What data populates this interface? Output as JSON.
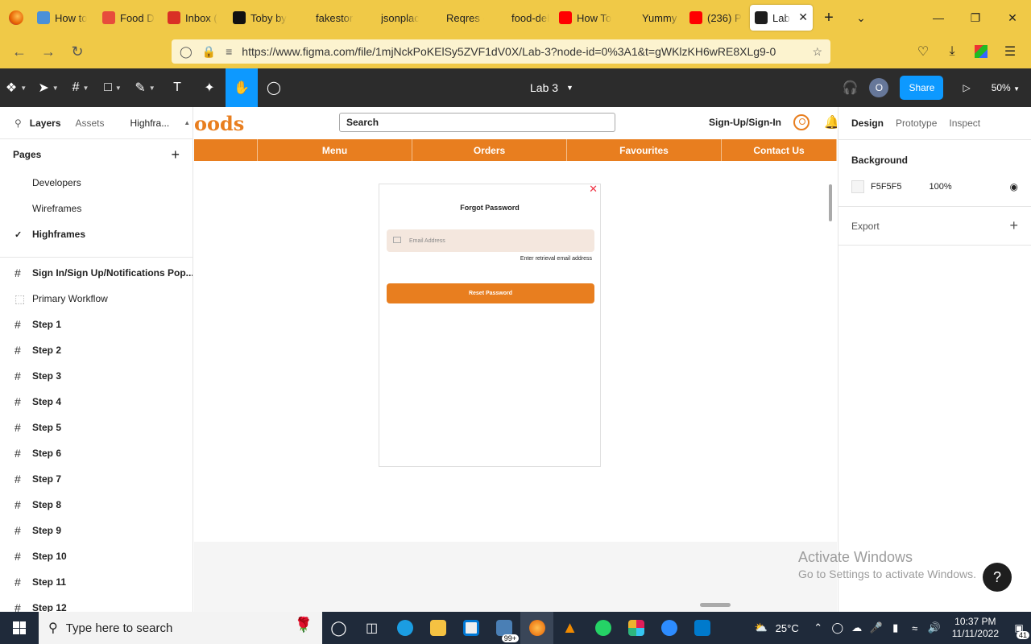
{
  "browser": {
    "tabs": [
      {
        "title": "How to",
        "icon": "pinned-tab-icon",
        "color": "#4a90d9"
      },
      {
        "title": "Food D",
        "icon": "food-icon",
        "color": "#e74c3c"
      },
      {
        "title": "Inbox (",
        "icon": "gmail-icon",
        "color": "#d93025"
      },
      {
        "title": "Toby by",
        "icon": "github-icon",
        "color": "#111111"
      },
      {
        "title": "fakestoreap",
        "icon": "",
        "color": ""
      },
      {
        "title": "jsonplaceho",
        "icon": "",
        "color": ""
      },
      {
        "title": "Reqres - A",
        "icon": "",
        "color": ""
      },
      {
        "title": "food-delive",
        "icon": "",
        "color": ""
      },
      {
        "title": "How To",
        "icon": "youtube-icon",
        "color": "#ff0000"
      },
      {
        "title": "Yummy for",
        "icon": "",
        "color": ""
      },
      {
        "title": "(236) P",
        "icon": "youtube-icon",
        "color": "#ff0000"
      },
      {
        "title": "Lab",
        "icon": "figma-icon",
        "color": "#1e1e1e",
        "active": true
      }
    ],
    "url": "https://www.figma.com/file/1mjNckPoKElSy5ZVF1dV0X/Lab-3?node-id=0%3A1&t=gWKlzKH6wRE8XLg9-0"
  },
  "figma": {
    "file_title": "Lab 3",
    "avatar_initial": "O",
    "share_label": "Share",
    "zoom": "50%"
  },
  "left_panel": {
    "tabs": [
      "Layers",
      "Assets",
      "Highfra..."
    ],
    "pages_header": "Pages",
    "pages": [
      "Developers",
      "Wireframes",
      "Highframes"
    ],
    "layers": [
      {
        "name": "Sign In/Sign Up/Notifications Pop...",
        "type": "frame"
      },
      {
        "name": "Primary Workflow",
        "type": "section"
      },
      {
        "name": "Step 1",
        "type": "frame"
      },
      {
        "name": "Step 2",
        "type": "frame"
      },
      {
        "name": "Step 3",
        "type": "frame"
      },
      {
        "name": "Step 4",
        "type": "frame"
      },
      {
        "name": "Step 5",
        "type": "frame"
      },
      {
        "name": "Step 6",
        "type": "frame"
      },
      {
        "name": "Step 7",
        "type": "frame"
      },
      {
        "name": "Step 8",
        "type": "frame"
      },
      {
        "name": "Step 9",
        "type": "frame"
      },
      {
        "name": "Step 10",
        "type": "frame"
      },
      {
        "name": "Step 11",
        "type": "frame"
      },
      {
        "name": "Step 12",
        "type": "frame"
      }
    ]
  },
  "design": {
    "logo": "oods",
    "search_label": "Search",
    "sign_link": "Sign-Up/Sign-In",
    "nav": [
      "",
      "Menu",
      "Orders",
      "Favourites",
      "Contact Us"
    ],
    "modal_title": "Forgot Password",
    "email_placeholder": "Email Address",
    "hint": "Enter retrieval email address",
    "reset_button": "Reset Password",
    "brand_color": "#e87e1f"
  },
  "right_panel": {
    "tabs": [
      "Design",
      "Prototype",
      "Inspect"
    ],
    "background_label": "Background",
    "bg_color": "F5F5F5",
    "bg_opacity": "100%",
    "export_label": "Export"
  },
  "watermark": {
    "line1": "Activate Windows",
    "line2": "Go to Settings to activate Windows."
  },
  "taskbar": {
    "search_placeholder": "Type here to search",
    "mail_badge": "99+",
    "temperature": "25°C",
    "time": "10:37 PM",
    "date": "11/11/2022",
    "notif_count": "41"
  }
}
